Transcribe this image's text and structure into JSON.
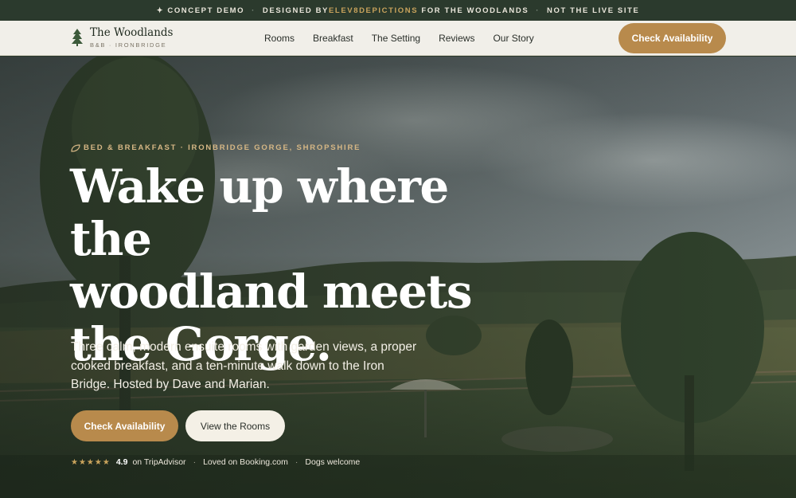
{
  "banner": {
    "part1": "✦ CONCEPT DEMO",
    "part2_prefix": "DESIGNED BY",
    "part2_brand": "ELEV8DEPICTIONS",
    "part2_suffix": " FOR THE WOODLANDS",
    "part3": "NOT THE LIVE SITE"
  },
  "logo": {
    "name": "The Woodlands",
    "sub": "B&B · IRONBRIDGE",
    "icon": "pine-tree-icon"
  },
  "nav": {
    "links": [
      "Rooms",
      "Breakfast",
      "The Setting",
      "Reviews",
      "Our Story"
    ],
    "cta": "Check Availability"
  },
  "hero": {
    "kicker": "BED & BREAKFAST · IRONBRIDGE GORGE, SHROPSHIRE",
    "headline_lines": [
      "Wake up where the",
      "woodland meets",
      "the Gorge."
    ],
    "lede": "Three calm, modern ensuite rooms with garden views, a proper cooked breakfast, and a ten-minute walk down to the Iron Bridge. Hosted by Dave and Marian.",
    "primary_cta": "Check Availability",
    "secondary_cta": "View the Rooms",
    "stars": "★★★★★",
    "rating": "4.9",
    "rating_source": "on TripAdvisor",
    "proof2": "Loved on Booking.com",
    "proof3": "Dogs welcome"
  },
  "colors": {
    "accent": "#b88a4c",
    "banner_bg": "#2b3a2d",
    "nav_bg": "#f1efe9",
    "kicker": "#d6b785"
  }
}
